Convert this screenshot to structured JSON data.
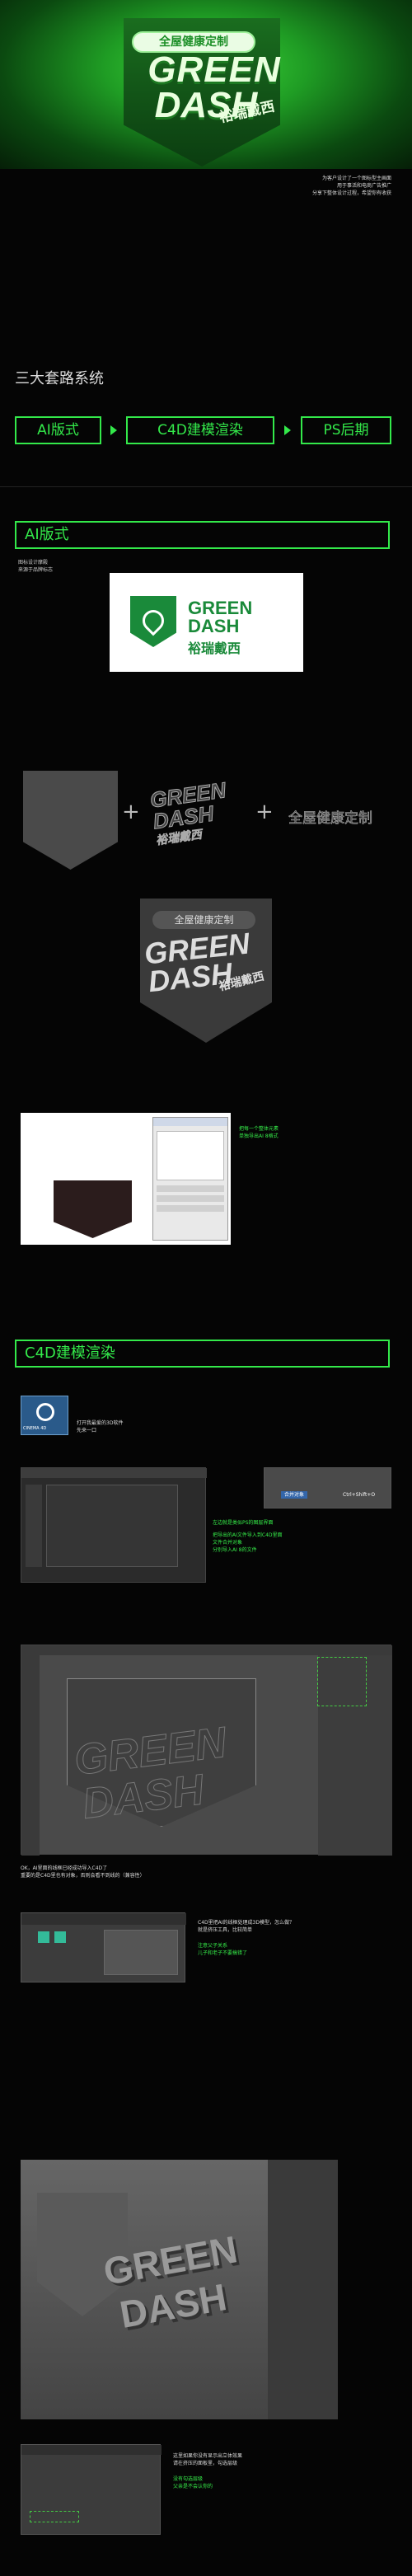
{
  "hero": {
    "badge_top": "全屋健康定制",
    "logo_line1": "GREEN",
    "logo_line2": "DASH",
    "logo_cn": "裕瑞戴西"
  },
  "intro": {
    "line1": "为客户设计了一个图标型主画面",
    "line2": "用于事活和电商广告推广",
    "line3": "分享下整体设计过程，希望你有收获"
  },
  "section_title": "三大套路系统",
  "steps": [
    "AI版式",
    "C4D建模渲染",
    "PS后期"
  ],
  "ai_section": {
    "title": "AI版式",
    "note1": "图标设计摩殿",
    "note2": "来源于品牌标志",
    "logo_line1": "GREEN",
    "logo_line2": "DASH",
    "logo_cn": "裕瑞戴西",
    "sign1": "+",
    "sign2": "+",
    "slogan": "全屋健康定制",
    "badge_top": "全屋健康定制",
    "badge_line1": "GREEN",
    "badge_line2": "DASH",
    "badge_cn": "裕瑞戴西",
    "tip1": "把每一个整体元素",
    "tip2": "单独导出AI 8格式"
  },
  "c4d_section": {
    "title": "C4D建模渲染",
    "app_label": "CINEMA 4D",
    "app_tip1": "打开我最爱的3D软件",
    "app_tip2": "先来一口",
    "tip_a1": "左边就是类似PS的图层界面",
    "tip_a2": "把导出的AI文件导入到C4D里面",
    "tip_a3": "文件合并对象",
    "tip_a4": "分别导入AI 8的文件",
    "menu_item1": "合并对象",
    "menu_item2": "Ctrl+Shift+O",
    "tip_b1": "OK，AI里面的线框已经成功导入C4D了",
    "tip_b2": "重要的是C4D里也有对象，否则会看不到线的（兼容性）",
    "tip_c1": "C4D里把AI的线框处理成3D模型，怎么做？",
    "tip_c2": "就是挤压工具，比较简单",
    "tip_c3": "注意父子关系",
    "tip_c4": "儿子和老子不要搞错了",
    "tip_d1": "这里如果你没有显示出立体效果",
    "tip_d2": "请在挤压的面板里，勾选层级",
    "tip_d3": "没有勾选层级",
    "tip_d4": "父亲是不会认你的"
  },
  "colors": {
    "accent": "#36f04a",
    "bg": "#050505"
  }
}
